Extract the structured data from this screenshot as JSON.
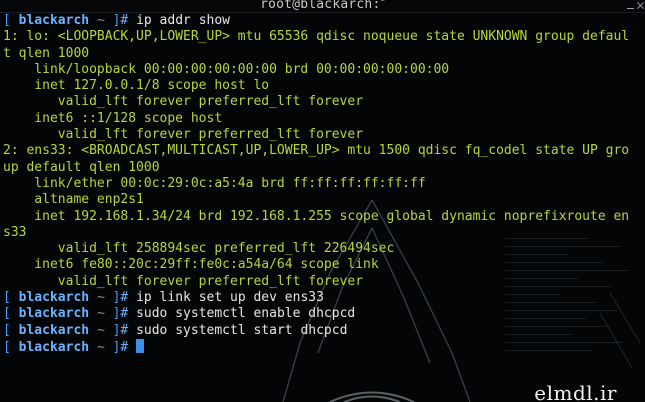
{
  "window": {
    "title": "root@blackarch:",
    "title_superscript": "~"
  },
  "prompt": {
    "open_bracket": "[",
    "host": "blackarch",
    "path": "~",
    "close_bracket": "]",
    "symbol": "#"
  },
  "commands": [
    "ip addr show",
    "ip link set up dev ens33",
    "sudo systemctl enable dhcpcd",
    "sudo systemctl start dhcpcd",
    ""
  ],
  "output_lines": [
    "1: lo: <LOOPBACK,UP,LOWER_UP> mtu 65536 qdisc noqueue state UNKNOWN group defaul",
    "t qlen 1000",
    "    link/loopback 00:00:00:00:00:00 brd 00:00:00:00:00:00",
    "    inet 127.0.0.1/8 scope host lo",
    "       valid_lft forever preferred_lft forever",
    "    inet6 ::1/128 scope host",
    "       valid_lft forever preferred_lft forever",
    "2: ens33: <BROADCAST,MULTICAST,UP,LOWER_UP> mtu 1500 qdisc fq_codel state UP gro",
    "up default qlen 1000",
    "    link/ether 00:0c:29:0c:a5:4a brd ff:ff:ff:ff:ff:ff",
    "    altname enp2s1",
    "    inet 192.168.1.34/24 brd 192.168.1.255 scope global dynamic noprefixroute en",
    "s33",
    "       valid_lft 258894sec preferred_lft 226494sec",
    "    inet6 fe80::20c:29ff:fe0c:a54a/64 scope link",
    "       valid_lft forever preferred_lft forever"
  ],
  "watermark": "elmdl.ir",
  "colors": {
    "background": "#030507",
    "output_text": "#b6d63a",
    "prompt_host": "#6ab4ff",
    "command_text": "#e6e6e6",
    "cursor": "#3f8fe6"
  }
}
